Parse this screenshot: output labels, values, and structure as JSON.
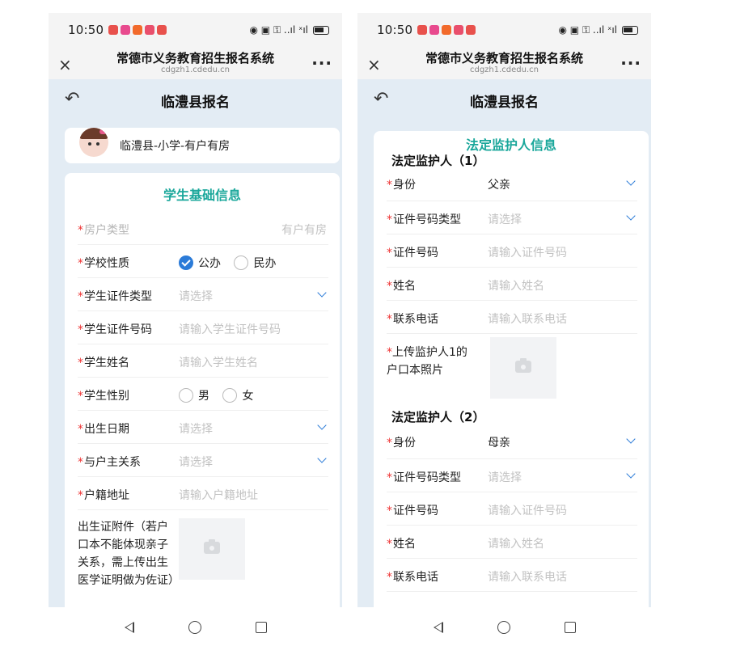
{
  "status": {
    "time": "10:50",
    "notif_colors": [
      "#e8514c",
      "#e84a8e",
      "#f26a2b",
      "#e94f6c",
      "#e8514c"
    ],
    "right_icons": "◉ ▣ ⚿ ..ıl ˣıl"
  },
  "browser": {
    "title": "常德市义务教育招生报名系统",
    "domain": "cdgzh1.cdedu.cn",
    "close_icon": "×",
    "menu_icon": "···"
  },
  "page": {
    "title": "临澧县报名",
    "back_icon": "↶"
  },
  "left": {
    "school": "临澧县-小学-有户有房",
    "section_title": "学生基础信息",
    "fields": [
      {
        "label": "房户类型",
        "value": "有户有房"
      },
      {
        "label": "学校性质",
        "opt1": "公办",
        "opt2": "民办"
      },
      {
        "label": "学生证件类型",
        "placeholder": "请选择"
      },
      {
        "label": "学生证件号码",
        "placeholder": "请输入学生证件号码"
      },
      {
        "label": "学生姓名",
        "placeholder": "请输入学生姓名"
      },
      {
        "label": "学生性别",
        "opt1": "男",
        "opt2": "女"
      },
      {
        "label": "出生日期",
        "placeholder": "请选择"
      },
      {
        "label": "与户主关系",
        "placeholder": "请选择"
      },
      {
        "label": "户籍地址",
        "placeholder": "请输入户籍地址"
      }
    ],
    "upload_label": "出生证附件（若户口本不能体现亲子关系，需上传出生医学证明做为佐证）"
  },
  "right": {
    "section_title": "法定监护人信息",
    "guardian1": {
      "title": "法定监护人（1）",
      "identity_label": "身份",
      "identity_value": "父亲",
      "idtype_label": "证件号码类型",
      "idtype_placeholder": "请选择",
      "idnum_label": "证件号码",
      "idnum_placeholder": "请输入证件号码",
      "name_label": "姓名",
      "name_placeholder": "请输入姓名",
      "phone_label": "联系电话",
      "phone_placeholder": "请输入联系电话",
      "upload_label": "上传监护人1的户口本照片"
    },
    "guardian2": {
      "title": "法定监护人（2）",
      "identity_label": "身份",
      "identity_value": "母亲",
      "idtype_label": "证件号码类型",
      "idtype_placeholder": "请选择",
      "idnum_label": "证件号码",
      "idnum_placeholder": "请输入证件号码",
      "name_label": "姓名",
      "name_placeholder": "请输入姓名",
      "phone_label": "联系电话",
      "phone_placeholder": "请输入联系电话"
    }
  },
  "colors": {
    "accent": "#1aa79b",
    "brand_blue": "#2b7bd8",
    "required": "#ee3333",
    "page_bg": "#e3ecf4"
  }
}
